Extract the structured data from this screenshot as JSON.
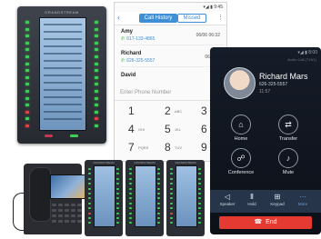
{
  "expansion_module": {
    "brand": "GRANDSTREAM"
  },
  "call_history": {
    "status_time": "9:45",
    "back_icon": "back-arrow-icon",
    "tabs": [
      {
        "label": "Call History",
        "active": true
      },
      {
        "label": "Missed",
        "active": false
      }
    ],
    "contacts": [
      {
        "name": "Amy",
        "number": "617-133-4865",
        "date": "06/06 06:32"
      },
      {
        "name": "Richard",
        "number": "626-325-5557",
        "date": "06/02 5"
      },
      {
        "name": "David",
        "number": "",
        "date": ""
      }
    ],
    "input_placeholder": "Enter Phone Number",
    "keypad": [
      {
        "digit": "1",
        "letters": ""
      },
      {
        "digit": "2",
        "letters": "ABC"
      },
      {
        "digit": "3",
        "letters": ""
      },
      {
        "digit": "4",
        "letters": "GHI"
      },
      {
        "digit": "5",
        "letters": "JKL"
      },
      {
        "digit": "6",
        "letters": ""
      },
      {
        "digit": "7",
        "letters": "PQRS"
      },
      {
        "digit": "8",
        "letters": "TUV"
      },
      {
        "digit": "9",
        "letters": ""
      }
    ],
    "accent_color": "#3f8fd6"
  },
  "call_screen": {
    "status_time": "8:00",
    "subtitle": "Audio Call (T1N1)",
    "caller_name": "Richard Mars",
    "caller_number": "626-325-5557",
    "call_duration": "11:57",
    "actions": [
      {
        "label": "Home",
        "icon": "home-icon",
        "glyph": "⌂"
      },
      {
        "label": "Transfer",
        "icon": "transfer-icon",
        "glyph": "⇄"
      },
      {
        "label": "Conference",
        "icon": "conference-icon",
        "glyph": "☍"
      },
      {
        "label": "Mute",
        "icon": "mute-icon",
        "glyph": "♪"
      }
    ],
    "bottom_bar": [
      {
        "label": "Speaker",
        "icon": "speaker-icon",
        "glyph": "◁"
      },
      {
        "label": "Hold",
        "icon": "hold-icon",
        "glyph": "Ⅱ"
      },
      {
        "label": "Keypad",
        "icon": "keypad-icon",
        "glyph": "⊞"
      },
      {
        "label": "More",
        "icon": "more-icon",
        "glyph": "⋯"
      }
    ],
    "end_label": "End",
    "end_color": "#e53a32"
  }
}
